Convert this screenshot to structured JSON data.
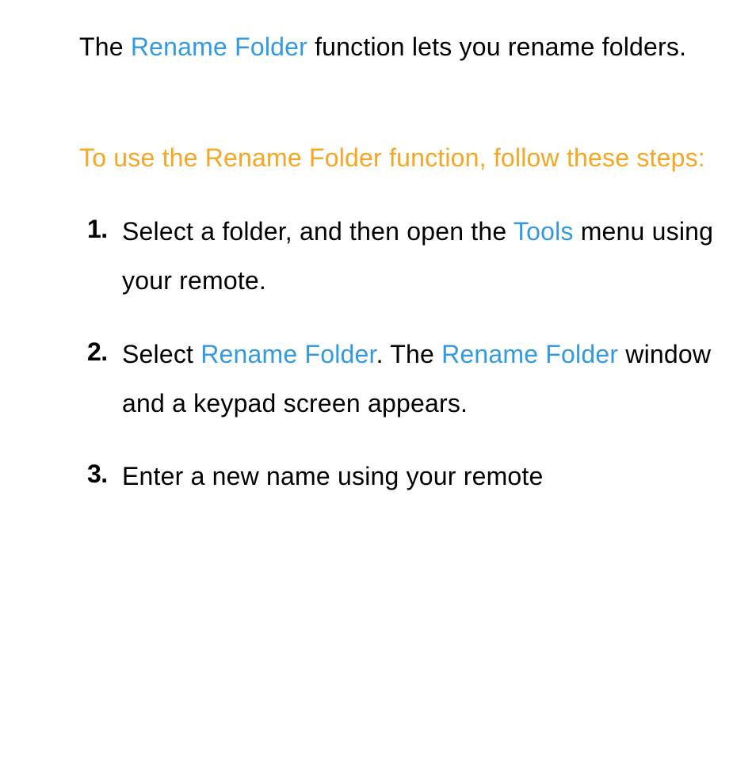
{
  "intro": {
    "part1": "The ",
    "highlight": "Rename Folder",
    "part2": " function lets you rename folders."
  },
  "section_heading": "To use the Rename Folder function, follow these steps:",
  "steps": [
    {
      "number": "1.",
      "parts": [
        {
          "text": "Select a folder, and then open the ",
          "highlight": false
        },
        {
          "text": "Tools",
          "highlight": true
        },
        {
          "text": " menu using your remote.",
          "highlight": false
        }
      ]
    },
    {
      "number": "2.",
      "parts": [
        {
          "text": "Select ",
          "highlight": false
        },
        {
          "text": "Rename Folder",
          "highlight": true
        },
        {
          "text": ". The ",
          "highlight": false
        },
        {
          "text": "Rename Folder",
          "highlight": true
        },
        {
          "text": " window and a keypad screen appears.",
          "highlight": false
        }
      ]
    },
    {
      "number": "3.",
      "parts": [
        {
          "text": "Enter a new name using your remote",
          "highlight": false
        }
      ]
    }
  ]
}
